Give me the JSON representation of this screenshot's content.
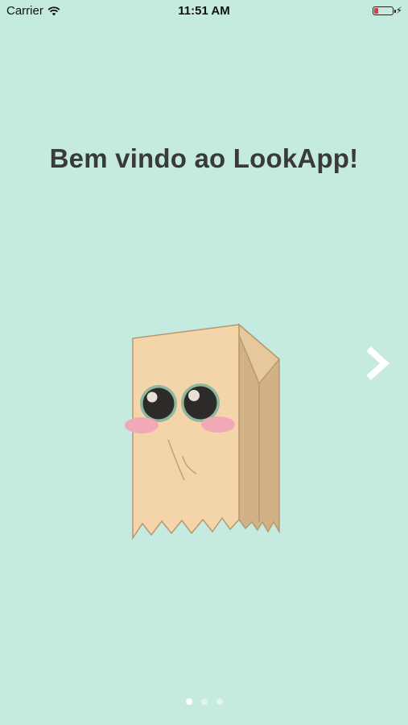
{
  "status_bar": {
    "carrier": "Carrier",
    "time": "11:51 AM",
    "battery_color": "#e23b3b"
  },
  "onboarding": {
    "title": "Bem vindo ao LookApp!",
    "illustration": "paper-bag-mascot",
    "next_icon": "chevron-right-icon",
    "page_count": 3,
    "current_page": 1
  },
  "colors": {
    "background": "#c5ebe1",
    "title": "#3a3a36",
    "bag_front": "#f4d5aa",
    "bag_side": "#d9b88c",
    "blush": "#f2a9b7"
  }
}
